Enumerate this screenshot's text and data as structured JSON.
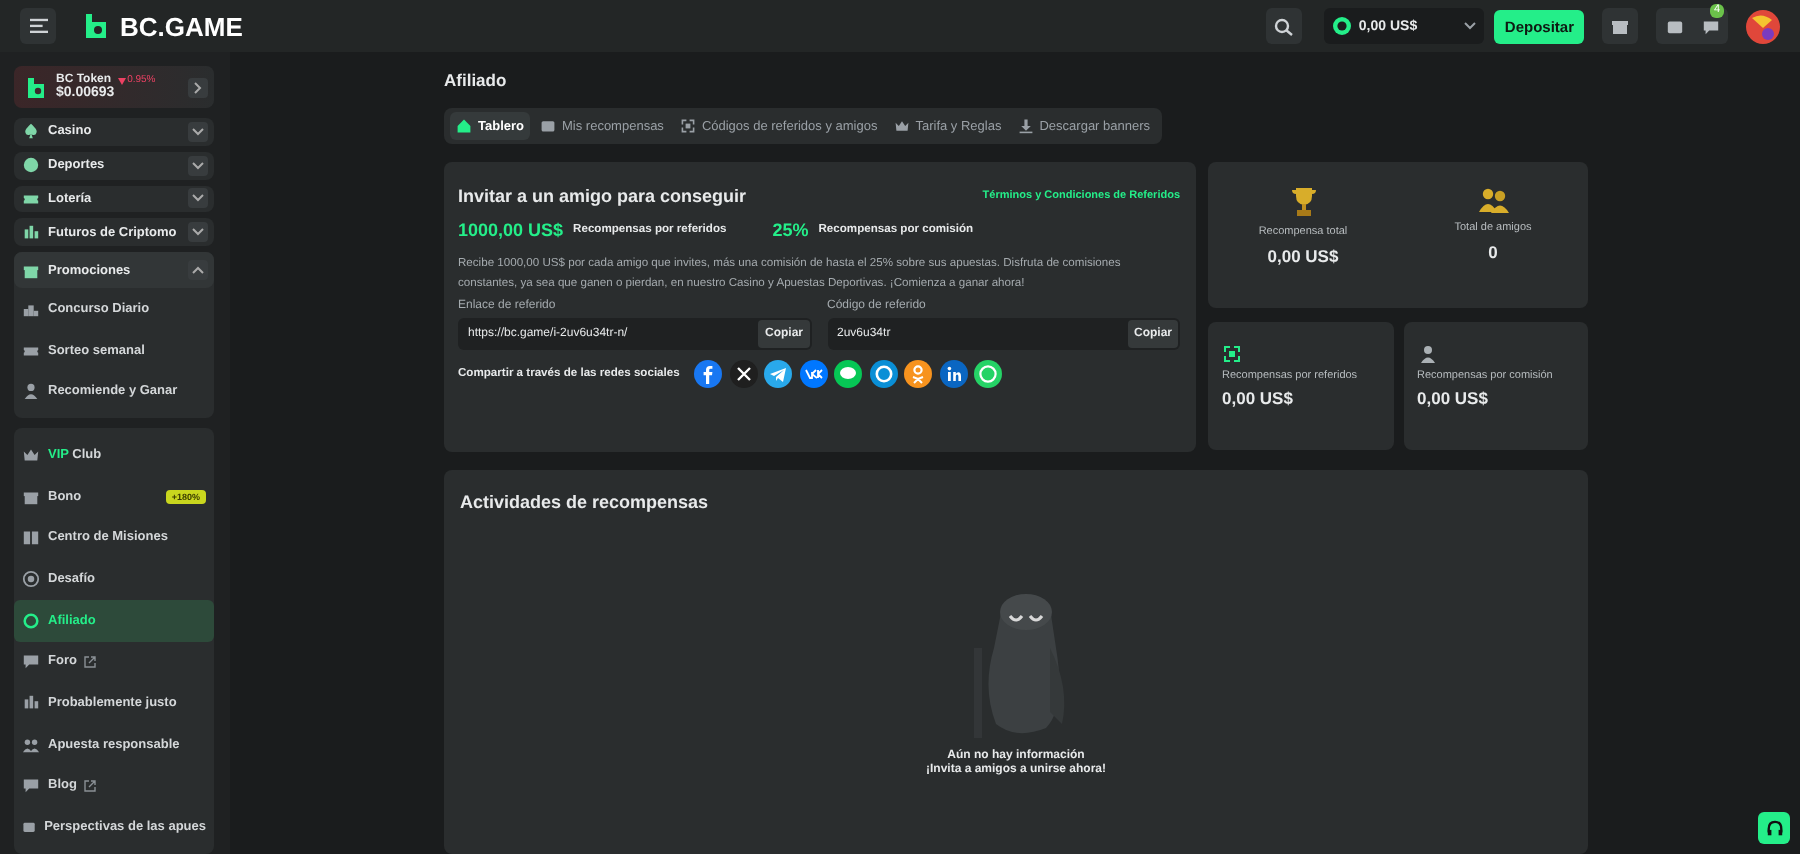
{
  "header": {
    "brand": "BC.GAME",
    "balance": "0,00 US$",
    "deposit": "Depositar",
    "notification_count": "4"
  },
  "sidebar": {
    "token": {
      "name": "BC Token",
      "change": "0.95%",
      "price": "$0.00693"
    },
    "categories": [
      {
        "label": "Casino",
        "expanded": false
      },
      {
        "label": "Deportes",
        "expanded": false
      },
      {
        "label": "Lotería",
        "expanded": false
      },
      {
        "label": "Futuros de Criptomo",
        "expanded": false
      }
    ],
    "promotions": {
      "label": "Promociones",
      "expanded": true,
      "items": [
        {
          "label": "Concurso Diario"
        },
        {
          "label": "Sorteo semanal"
        },
        {
          "label": "Recomiende y Ganar"
        }
      ]
    },
    "menu": [
      {
        "kind": "vip",
        "accent": "VIP",
        "label": "Club",
        "selected": false
      },
      {
        "kind": "badge",
        "label": "Bono",
        "badge": "+180%",
        "selected": false
      },
      {
        "kind": "plain",
        "label": "Centro de Misiones",
        "selected": false
      },
      {
        "kind": "plain",
        "label": "Desafío",
        "selected": false
      },
      {
        "kind": "plain",
        "label": "Afiliado",
        "selected": true
      },
      {
        "kind": "external",
        "label": "Foro",
        "selected": false
      },
      {
        "kind": "plain",
        "label": "Probablemente justo",
        "selected": false
      },
      {
        "kind": "plain",
        "label": "Apuesta responsable",
        "selected": false
      },
      {
        "kind": "external",
        "label": "Blog",
        "selected": false
      },
      {
        "kind": "plain",
        "label": "Perspectivas de las apues",
        "selected": false
      }
    ]
  },
  "page": {
    "title": "Afiliado",
    "tabs": [
      {
        "label": "Tablero",
        "selected": true
      },
      {
        "label": "Mis recompensas",
        "selected": false
      },
      {
        "label": "Códigos de referidos y amigos",
        "selected": false
      },
      {
        "label": "Tarifa y Reglas",
        "selected": false
      },
      {
        "label": "Descargar banners",
        "selected": false
      }
    ],
    "invite": {
      "title": "Invitar a un amigo para conseguir",
      "terms_link": "Términos y Condiciones de Referidos",
      "highlights": [
        {
          "value": "1000,00 US$",
          "label": "Recompensas por referidos"
        },
        {
          "value": "25%",
          "label": "Recompensas por comisión"
        }
      ],
      "description": "Recibe 1000,00 US$ por cada amigo que invites, más una comisión de hasta el 25% sobre sus apuestas. Disfruta de comisiones constantes, ya sea que ganen o pierdan, en nuestro Casino y Apuestas Deportivas. ¡Comienza a ganar ahora!",
      "fields": [
        {
          "label": "Enlace de referido",
          "value": "https://bc.game/i-2uv6u34tr-n/",
          "button": "Copiar"
        },
        {
          "label": "Código de referido",
          "value": "2uv6u34tr",
          "button": "Copiar"
        }
      ],
      "share_label": "Compartir a través de las redes sociales",
      "socials": [
        {
          "kind": "facebook",
          "color": "#1877f2"
        },
        {
          "kind": "x",
          "color": "#1f1f1f"
        },
        {
          "kind": "telegram",
          "color": "#29a9eb"
        },
        {
          "kind": "vk",
          "color": "#0077ff"
        },
        {
          "kind": "line",
          "color": "#06c755"
        },
        {
          "kind": "skype",
          "color": "#0a8fd6"
        },
        {
          "kind": "ok",
          "color": "#f7931e"
        },
        {
          "kind": "linkedin",
          "color": "#0a66c2"
        },
        {
          "kind": "whatsapp",
          "color": "#25d366"
        }
      ]
    },
    "totals": [
      {
        "label": "Recompensa total",
        "value": "0,00 US$"
      },
      {
        "label": "Total de amigos",
        "value": "0"
      }
    ],
    "rewards": [
      {
        "label": "Recompensas por referidos",
        "value": "0,00 US$"
      },
      {
        "label": "Recompensas por comisión",
        "value": "0,00 US$"
      }
    ],
    "activities": {
      "title": "Actividades de recompensas",
      "empty_lines": [
        "Aún no hay información",
        "¡Invita a amigos a unirse ahora!"
      ]
    }
  }
}
